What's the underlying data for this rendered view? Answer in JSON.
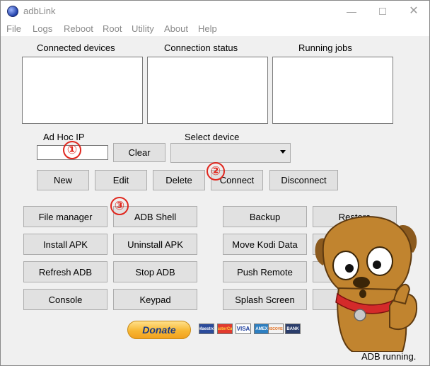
{
  "window": {
    "title": "adbLink"
  },
  "menu": [
    "File",
    "Logs",
    "Reboot",
    "Root",
    "Utility",
    "About",
    "Help"
  ],
  "panels": {
    "connected_devices": "Connected devices",
    "connection_status": "Connection status",
    "running_jobs": "Running jobs"
  },
  "adhoc": {
    "label": "Ad Hoc IP",
    "value": "",
    "clear": "Clear"
  },
  "select_device": {
    "label": "Select device",
    "value": ""
  },
  "device_buttons": {
    "new": "New",
    "edit": "Edit",
    "delete": "Delete",
    "connect": "Connect",
    "disconnect": "Disconnect"
  },
  "actions": {
    "file_manager": "File manager",
    "adb_shell": "ADB Shell",
    "backup": "Backup",
    "restore": "Restore",
    "install_apk": "Install APK",
    "uninstall_apk": "Uninstall APK",
    "move_kodi_data": "Move Kodi Data",
    "refresh_adb": "Refresh ADB",
    "stop_adb": "Stop ADB",
    "push_remote": "Push Remote",
    "console": "Console",
    "keypad": "Keypad",
    "splash_screen": "Splash Screen"
  },
  "markers": [
    "①",
    "②",
    "③"
  ],
  "donate": {
    "label": "Donate",
    "cards": [
      "Maestro",
      "MasterCard",
      "VISA",
      "AMEX",
      "DISCOVER",
      "BANK"
    ]
  },
  "status": "ADB running.",
  "colors": {
    "marker": "#e0271e",
    "mascot": "#b77a2b",
    "donate": "#f7b733"
  }
}
